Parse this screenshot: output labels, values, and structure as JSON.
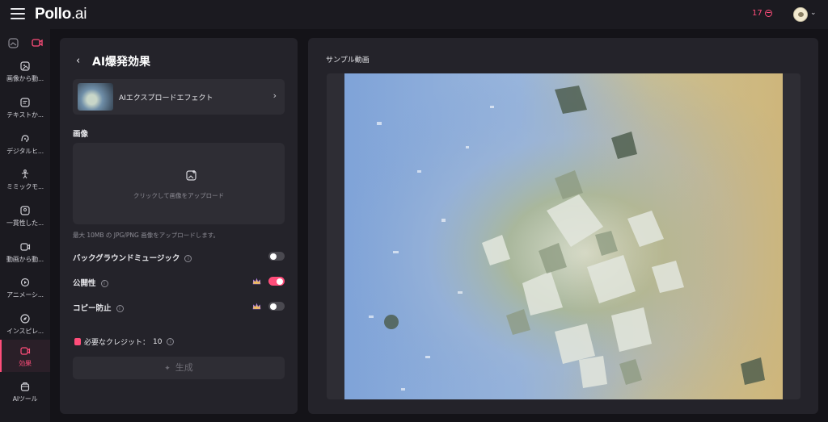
{
  "header": {
    "logo_main": "Pollo",
    "logo_suffix": ".ai",
    "credits": "17"
  },
  "sidebar": {
    "items": [
      {
        "label": "画像から動...",
        "icon": "image-to-video-icon"
      },
      {
        "label": "テキストか...",
        "icon": "text-to-video-icon"
      },
      {
        "label": "デジタルヒ...",
        "icon": "digital-human-icon"
      },
      {
        "label": "ミミックモ...",
        "icon": "mimic-motion-icon"
      },
      {
        "label": "一貫性した...",
        "icon": "consistent-character-icon"
      },
      {
        "label": "動画から動...",
        "icon": "video-to-video-icon"
      },
      {
        "label": "アニメーシ...",
        "icon": "animation-icon"
      },
      {
        "label": "インスピレ...",
        "icon": "inspiration-compass-icon"
      },
      {
        "label": "効果",
        "icon": "effects-icon",
        "active": true
      },
      {
        "label": "AIツール",
        "icon": "ai-tools-icon"
      }
    ]
  },
  "panel": {
    "title": "AI爆発効果",
    "effect_name": "AIエクスプロードエフェクト",
    "image_label": "画像",
    "upload_text": "クリックして画像をアップロード",
    "upload_hint": "最大 10MB の JPG/PNG 画像をアップロードします。",
    "options": [
      {
        "label": "バックグラウンドミュージック",
        "on": false,
        "premium": false
      },
      {
        "label": "公開性",
        "on": true,
        "premium": true
      },
      {
        "label": "コピー防止",
        "on": false,
        "premium": true
      }
    ],
    "credit_label": "必要なクレジット：",
    "credit_value": "10",
    "generate_label": "生成"
  },
  "preview": {
    "label": "サンプル動画"
  },
  "colors": {
    "accent": "#ff4d7a",
    "bg": "#141318",
    "panel": "#24232a"
  }
}
